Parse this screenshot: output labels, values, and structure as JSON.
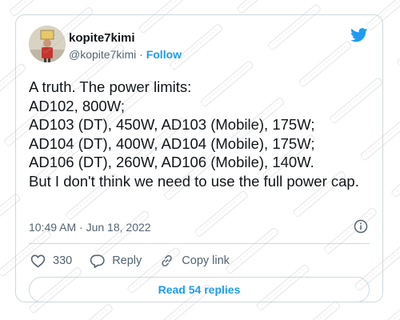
{
  "user": {
    "display_name": "kopite7kimi",
    "handle": "@kopite7kimi",
    "separator": "·",
    "follow_label": "Follow"
  },
  "tweet": {
    "lines": [
      "A truth. The power limits:",
      "AD102, 800W;",
      "AD103 (DT), 450W, AD103 (Mobile), 175W;",
      "AD104 (DT), 400W, AD104 (Mobile), 175W;",
      "AD106 (DT), 260W, AD106 (Mobile), 140W.",
      "But I don't think we need to use the full power cap."
    ],
    "timestamp": "10:49 AM · Jun 18, 2022"
  },
  "actions": {
    "like_count": "330",
    "reply_label": "Reply",
    "copy_link_label": "Copy link"
  },
  "read_replies_label": "Read 54 replies",
  "icons": {
    "logo": "twitter-bird-icon",
    "info": "info-icon",
    "like": "heart-icon",
    "reply": "speech-bubble-icon",
    "copy_link": "link-icon"
  },
  "colors": {
    "accent": "#1d9bf0",
    "text": "#0f1419",
    "secondary_text": "#536471",
    "border": "#cfd9de"
  }
}
